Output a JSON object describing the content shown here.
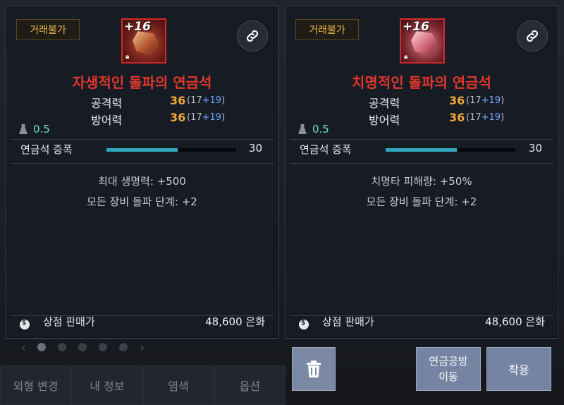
{
  "background": {
    "nav": [
      "외형 변경",
      "내 정보",
      "염색",
      "옵션"
    ],
    "pager": {
      "prev": "‹",
      "next": "›",
      "dots": 5,
      "active": 0
    }
  },
  "left_item": {
    "trade_badge": "거래불가",
    "enhance": "+16",
    "name": "자생적인 돌파의 연금석",
    "stats": [
      {
        "label": "공격력",
        "value": "36",
        "base": "(17",
        "bonus": "+19",
        "close": ")"
      },
      {
        "label": "방어력",
        "value": "36",
        "base": "(17",
        "bonus": "+19",
        "close": ")"
      }
    ],
    "weight": "0.5",
    "alchemy": {
      "label": "연금석 증폭",
      "value": "30",
      "progress": 0.55
    },
    "effects": [
      "최대 생명력: +500",
      "모든 장비 돌파 단계: +2"
    ],
    "shop": {
      "label": "상점 판매가",
      "price": "48,600 은화"
    }
  },
  "right_item": {
    "trade_badge": "거래불가",
    "enhance": "+16",
    "name": "치명적인 돌파의 연금석",
    "stats": [
      {
        "label": "공격력",
        "value": "36",
        "base": "(17",
        "bonus": "+19",
        "close": ")"
      },
      {
        "label": "방어력",
        "value": "36",
        "base": "(17",
        "bonus": "+19",
        "close": ")"
      }
    ],
    "weight": "0.5",
    "alchemy": {
      "label": "연금석 증폭",
      "value": "30",
      "progress": 0.55
    },
    "effects": [
      "치명타 피해량: +50%",
      "모든 장비 돌파 단계: +2"
    ],
    "shop": {
      "label": "상점 판매가",
      "price": "48,600 은화"
    }
  },
  "actions": {
    "alchemy_line1": "연금공방",
    "alchemy_line2": "이동",
    "equip": "착용"
  },
  "colors": {
    "item_name": "#e1372b",
    "stat_value": "#f0a83a",
    "progress": "#2fa8be",
    "weight": "#6ee0c8",
    "badge_text": "#e9b74a"
  }
}
